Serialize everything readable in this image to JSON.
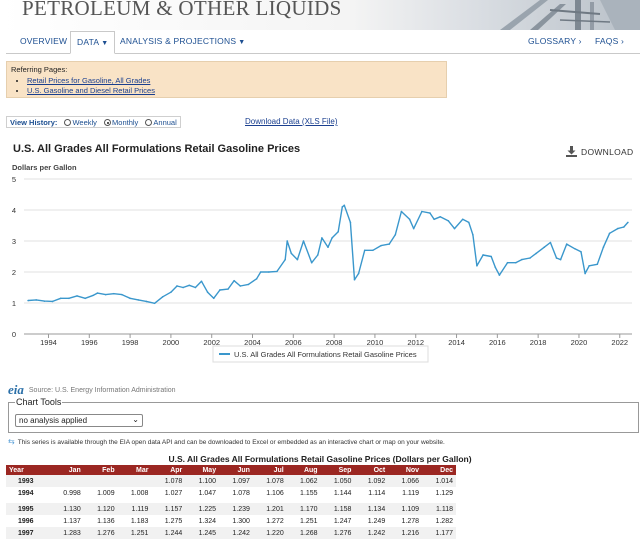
{
  "header": {
    "title": "PETROLEUM & OTHER LIQUIDS"
  },
  "nav": {
    "overview": "OVERVIEW",
    "data": "DATA",
    "analysis": "ANALYSIS & PROJECTIONS",
    "glossary": "GLOSSARY ›",
    "faqs": "FAQS ›"
  },
  "referring": {
    "heading": "Referring Pages:",
    "links": [
      "Retail Prices for Gasoline, All Grades",
      "U.S. Gasoline and Diesel Retail Prices"
    ]
  },
  "view_history": {
    "label": "View History:",
    "options": [
      "Weekly",
      "Monthly",
      "Annual"
    ],
    "selected": "Monthly"
  },
  "download_data": "Download Data (XLS File)",
  "download_button": "DOWNLOAD",
  "chart_data": {
    "type": "line",
    "title": "U.S. All Grades All Formulations Retail Gasoline Prices",
    "ylabel": "Dollars per Gallon",
    "xlabel": "",
    "ylim": [
      0,
      5
    ],
    "xlim": [
      1992.8,
      2022.6
    ],
    "y_ticks": [
      "0",
      "1",
      "2",
      "3",
      "4",
      "5"
    ],
    "x_ticks": [
      "1994",
      "1996",
      "1998",
      "2000",
      "2002",
      "2004",
      "2006",
      "2008",
      "2010",
      "2012",
      "2014",
      "2016",
      "2018",
      "2020",
      "2022"
    ],
    "grid": true,
    "legend_position": "bottom",
    "series": [
      {
        "name": "U.S. All Grades All Formulations Retail Gasoline Prices",
        "color": "#3a97cc",
        "x": [
          1993.0,
          1993.4,
          1993.8,
          1994.2,
          1994.6,
          1995.0,
          1995.4,
          1995.8,
          1996.2,
          1996.4,
          1996.8,
          1997.2,
          1997.6,
          1998.0,
          1998.4,
          1998.8,
          1999.2,
          1999.6,
          2000.0,
          2000.3,
          2000.6,
          2000.9,
          2001.2,
          2001.5,
          2001.8,
          2002.1,
          2002.4,
          2002.8,
          2003.1,
          2003.4,
          2003.8,
          2004.2,
          2004.4,
          2004.8,
          2005.2,
          2005.6,
          2005.7,
          2005.9,
          2006.2,
          2006.5,
          2006.9,
          2007.2,
          2007.4,
          2007.7,
          2007.9,
          2008.2,
          2008.4,
          2008.5,
          2008.8,
          2009.0,
          2009.2,
          2009.5,
          2009.9,
          2010.3,
          2010.7,
          2011.0,
          2011.3,
          2011.7,
          2011.9,
          2012.3,
          2012.7,
          2012.9,
          2013.2,
          2013.6,
          2013.9,
          2014.3,
          2014.6,
          2014.8,
          2015.0,
          2015.3,
          2015.7,
          2015.9,
          2016.1,
          2016.5,
          2016.9,
          2017.2,
          2017.6,
          2017.9,
          2018.3,
          2018.6,
          2018.9,
          2019.1,
          2019.4,
          2019.8,
          2020.1,
          2020.3,
          2020.5,
          2020.9,
          2021.2,
          2021.5,
          2021.9,
          2022.2,
          2022.4
        ],
        "values": [
          1.08,
          1.1,
          1.06,
          1.05,
          1.15,
          1.15,
          1.23,
          1.15,
          1.25,
          1.32,
          1.27,
          1.3,
          1.27,
          1.15,
          1.1,
          1.05,
          0.99,
          1.2,
          1.35,
          1.55,
          1.5,
          1.57,
          1.5,
          1.7,
          1.35,
          1.15,
          1.42,
          1.45,
          1.72,
          1.55,
          1.6,
          1.78,
          2.0,
          2.0,
          2.02,
          2.4,
          3.0,
          2.6,
          2.4,
          3.0,
          2.3,
          2.55,
          3.1,
          2.8,
          3.1,
          3.3,
          4.1,
          4.15,
          3.6,
          1.75,
          1.95,
          2.7,
          2.7,
          2.85,
          2.9,
          3.2,
          3.95,
          3.7,
          3.4,
          3.95,
          3.9,
          3.7,
          3.78,
          3.65,
          3.4,
          3.7,
          3.6,
          3.2,
          2.2,
          2.55,
          2.5,
          2.15,
          1.9,
          2.3,
          2.3,
          2.4,
          2.45,
          2.6,
          2.8,
          2.95,
          2.45,
          2.4,
          2.9,
          2.75,
          2.65,
          1.95,
          2.2,
          2.25,
          2.8,
          3.25,
          3.4,
          3.45,
          3.6
        ]
      }
    ]
  },
  "source": "Source: U.S. Energy Information Administration",
  "eia_logo": "eia",
  "chart_tools": {
    "label": "Chart Tools",
    "select_value": "no analysis applied"
  },
  "api_note": "This series is available through the EIA open data API and can be downloaded to Excel or embedded as an interactive chart or map on your website.",
  "table": {
    "title": "U.S. All Grades All Formulations Retail Gasoline Prices (Dollars per Gallon)",
    "headers": [
      "Year",
      "Jan",
      "Feb",
      "Mar",
      "Apr",
      "May",
      "Jun",
      "Jul",
      "Aug",
      "Sep",
      "Oct",
      "Nov",
      "Dec"
    ],
    "rows": [
      [
        "1993",
        "",
        "",
        "",
        "1.078",
        "1.100",
        "1.097",
        "1.078",
        "1.062",
        "1.050",
        "1.092",
        "1.066",
        "1.014"
      ],
      [
        "1994",
        "0.998",
        "1.009",
        "1.008",
        "1.027",
        "1.047",
        "1.078",
        "1.106",
        "1.155",
        "1.144",
        "1.114",
        "1.119",
        "1.129"
      ],
      [
        "1995",
        "1.130",
        "1.120",
        "1.119",
        "1.157",
        "1.225",
        "1.239",
        "1.201",
        "1.170",
        "1.158",
        "1.134",
        "1.109",
        "1.118"
      ],
      [
        "1996",
        "1.137",
        "1.136",
        "1.183",
        "1.275",
        "1.324",
        "1.300",
        "1.272",
        "1.251",
        "1.247",
        "1.249",
        "1.278",
        "1.282"
      ],
      [
        "1997",
        "1.283",
        "1.276",
        "1.251",
        "1.244",
        "1.245",
        "1.242",
        "1.220",
        "1.268",
        "1.276",
        "1.242",
        "1.216",
        "1.177"
      ]
    ]
  }
}
